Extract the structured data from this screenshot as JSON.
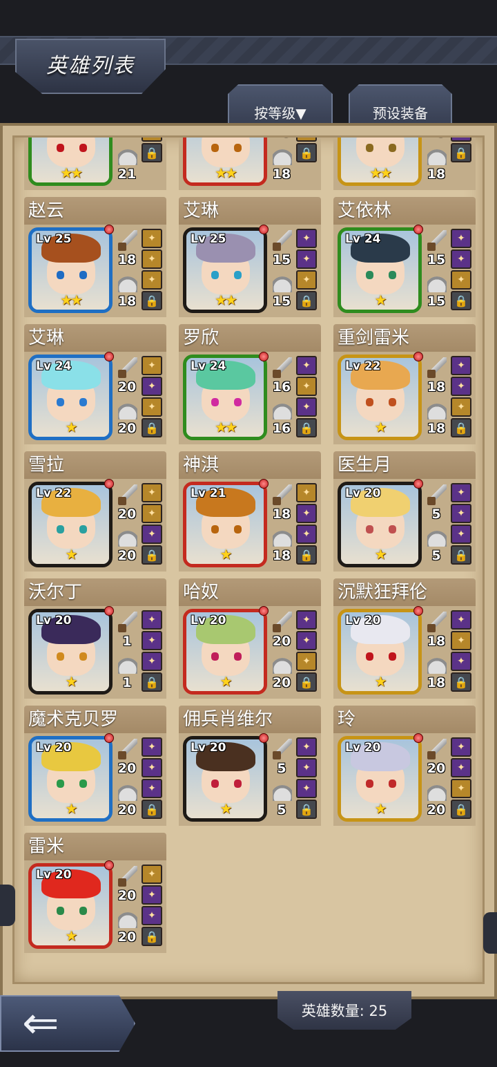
{
  "header": {
    "title": "英雄列表"
  },
  "toolbar": {
    "sort_label": "按等级▼",
    "preset_label": "预设装备"
  },
  "footer": {
    "hero_count_label": "英雄数量: 25",
    "back_icon": "left-arrow-icon"
  },
  "heroes": [
    {
      "name": "",
      "level": "",
      "atk": "21",
      "def": "21",
      "stars": "★★",
      "frame": "green",
      "hair": "#e8e8e8",
      "eye": "#c0141c",
      "slots": [
        "gold",
        "gold",
        "lock"
      ]
    },
    {
      "name": "",
      "level": "",
      "atk": "18",
      "def": "18",
      "stars": "★★",
      "frame": "red",
      "hair": "#c2341c",
      "eye": "#b8650e",
      "slots": [
        "gold",
        "gold",
        "lock"
      ]
    },
    {
      "name": "",
      "level": "",
      "atk": "18",
      "def": "18",
      "stars": "★★",
      "frame": "gold",
      "hair": "#d8b060",
      "eye": "#8a6a20",
      "slots": [
        "purple",
        "purple",
        "lock"
      ]
    },
    {
      "name": "赵云",
      "level": "Lv 25",
      "atk": "18",
      "def": "18",
      "stars": "★★",
      "frame": "blue",
      "hair": "#a6501e",
      "eye": "#1e6cc4",
      "slots": [
        "gold",
        "gold",
        "gold",
        "lock"
      ]
    },
    {
      "name": "艾琳",
      "level": "Lv 25",
      "atk": "15",
      "def": "15",
      "stars": "★★",
      "frame": "black",
      "hair": "#9a90b0",
      "eye": "#2aa0c8",
      "slots": [
        "purple",
        "purple",
        "gold",
        "lock"
      ]
    },
    {
      "name": "艾依林",
      "level": "Lv 24",
      "atk": "15",
      "def": "15",
      "stars": "★",
      "frame": "green",
      "hair": "#2a3a4a",
      "eye": "#2a8a5a",
      "slots": [
        "purple",
        "purple",
        "gold",
        "lock"
      ]
    },
    {
      "name": "艾琳",
      "level": "Lv 24",
      "atk": "20",
      "def": "20",
      "stars": "★",
      "frame": "blue",
      "hair": "#8ae0e8",
      "eye": "#2a7ad0",
      "slots": [
        "gold",
        "purple",
        "gold",
        "lock"
      ]
    },
    {
      "name": "罗欣",
      "level": "Lv 24",
      "atk": "16",
      "def": "16",
      "stars": "★★",
      "frame": "green",
      "hair": "#5ac8a0",
      "eye": "#d02aa0",
      "slots": [
        "purple",
        "gold",
        "purple",
        "lock"
      ]
    },
    {
      "name": "重剑雷米",
      "level": "Lv 22",
      "atk": "18",
      "def": "18",
      "stars": "★",
      "frame": "gold",
      "hair": "#e8a850",
      "eye": "#c0501e",
      "slots": [
        "purple",
        "purple",
        "gold",
        "lock"
      ]
    },
    {
      "name": "雪拉",
      "level": "Lv 22",
      "atk": "20",
      "def": "20",
      "stars": "★",
      "frame": "black",
      "hair": "#e8b040",
      "eye": "#2aa0a0",
      "slots": [
        "gold",
        "gold",
        "purple",
        "lock"
      ]
    },
    {
      "name": "神淇",
      "level": "Lv 21",
      "atk": "18",
      "def": "18",
      "stars": "★",
      "frame": "red",
      "hair": "#c8781e",
      "eye": "#b8650e",
      "slots": [
        "gold",
        "purple",
        "purple",
        "lock"
      ]
    },
    {
      "name": "医生月",
      "level": "Lv 20",
      "atk": "5",
      "def": "5",
      "stars": "★",
      "frame": "black",
      "hair": "#f0d070",
      "eye": "#c05050",
      "slots": [
        "purple",
        "purple",
        "purple",
        "lock"
      ]
    },
    {
      "name": "沃尔丁",
      "level": "Lv 20",
      "atk": "1",
      "def": "1",
      "stars": "★",
      "frame": "black",
      "hair": "#3a2a5a",
      "eye": "#d08a1e",
      "slots": [
        "purple",
        "purple",
        "purple",
        "lock"
      ]
    },
    {
      "name": "哈奴",
      "level": "Lv 20",
      "atk": "20",
      "def": "20",
      "stars": "★",
      "frame": "red",
      "hair": "#a8c870",
      "eye": "#c01e5a",
      "slots": [
        "purple",
        "purple",
        "gold",
        "lock"
      ]
    },
    {
      "name": "沉默狂拜伦",
      "level": "Lv 20",
      "atk": "18",
      "def": "18",
      "stars": "★",
      "frame": "gold",
      "hair": "#e8e8f0",
      "eye": "#c0141c",
      "slots": [
        "purple",
        "gold",
        "purple",
        "lock"
      ]
    },
    {
      "name": "魔术克贝罗",
      "level": "Lv 20",
      "atk": "20",
      "def": "20",
      "stars": "★",
      "frame": "blue",
      "hair": "#e8c840",
      "eye": "#2a9a4a",
      "slots": [
        "purple",
        "purple",
        "purple",
        "lock"
      ]
    },
    {
      "name": "佣兵肖维尔",
      "level": "Lv 20",
      "atk": "5",
      "def": "5",
      "stars": "★",
      "frame": "black",
      "hair": "#4a3020",
      "eye": "#c01e3a",
      "slots": [
        "purple",
        "purple",
        "purple",
        "lock"
      ]
    },
    {
      "name": "玲",
      "level": "Lv 20",
      "atk": "20",
      "def": "20",
      "stars": "★",
      "frame": "gold",
      "hair": "#c8c8e0",
      "eye": "#c02a2a",
      "slots": [
        "purple",
        "purple",
        "gold",
        "lock"
      ]
    },
    {
      "name": "雷米",
      "level": "Lv 20",
      "atk": "20",
      "def": "20",
      "stars": "★",
      "frame": "red",
      "hair": "#e0281e",
      "eye": "#2a8a4a",
      "slots": [
        "gold",
        "purple",
        "purple",
        "lock"
      ]
    }
  ]
}
